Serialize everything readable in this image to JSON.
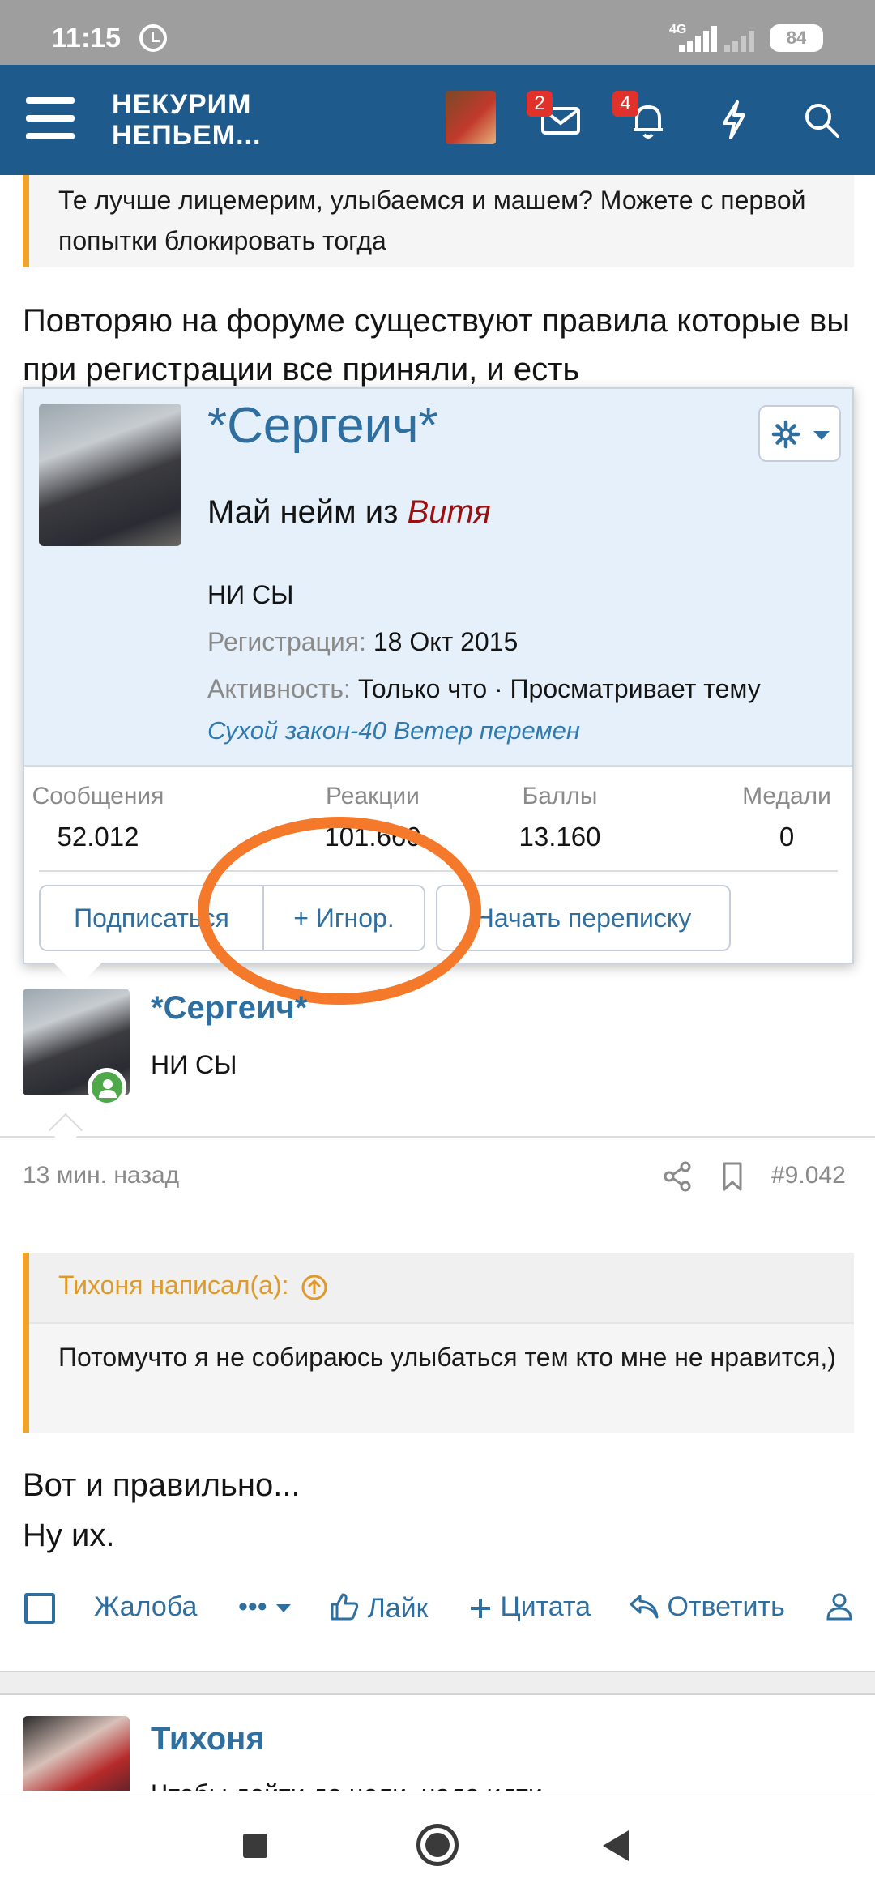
{
  "status_bar": {
    "time": "11:15",
    "network": "4G",
    "battery": "84"
  },
  "header": {
    "logo_line1": "НЕКУРИМ",
    "logo_line2": "НЕПЬЕМ...",
    "messages_badge": "2",
    "alerts_badge": "4",
    "brand_color": "#1e5a8c"
  },
  "top_quote": {
    "text": "Те лучше лицемерим, улыбаемся и машем? Можете с первой попытки блокировать тогда"
  },
  "paragraph": {
    "text": "Повторяю на форуме существуют правила которые вы при регистрации все приняли, и есть"
  },
  "profile_card": {
    "name": "*Сергеич*",
    "title_prefix": "Май нейм из",
    "title_highlight": "Витя",
    "status": "НИ СЫ",
    "reg_label": "Регистрация:",
    "reg_value": "18 Окт 2015",
    "activity_label": "Активность:",
    "activity_value": "Только что · Просматривает тему",
    "activity_link": "Сухой закон-40 Ветер перемен",
    "stats": [
      {
        "label": "Сообщения",
        "value": "52.012"
      },
      {
        "label": "Реакции",
        "value": "101.660"
      },
      {
        "label": "Баллы",
        "value": "13.160"
      },
      {
        "label": "Медали",
        "value": "0"
      }
    ],
    "buttons": {
      "follow": "Подписаться",
      "ignore": "+ Игнор.",
      "message": "Начать переписку"
    }
  },
  "post": {
    "author": "*Сергеич*",
    "author_status": "НИ СЫ",
    "time": "13 мин. назад",
    "number": "#9.042",
    "quote_author": "Тихоня написал(а):",
    "quote_text": "Потомучто я не собираюсь улыбаться тем кто мне не нравится,)",
    "reply_line1": "Вот и правильно...",
    "reply_line2": "Ну их."
  },
  "actions": {
    "report": "Жалоба",
    "more": "•••",
    "like": "Лайк",
    "quote": "Цитата",
    "reply": "Ответить"
  },
  "next_post": {
    "author": "Тихоня",
    "peek": "Чтобы дойти до цели, надо идти"
  },
  "colors": {
    "accent": "#2f6f9f",
    "quote_bar": "#f0a32b",
    "highlight_circle": "#f4792a",
    "badge": "#e0322b"
  }
}
